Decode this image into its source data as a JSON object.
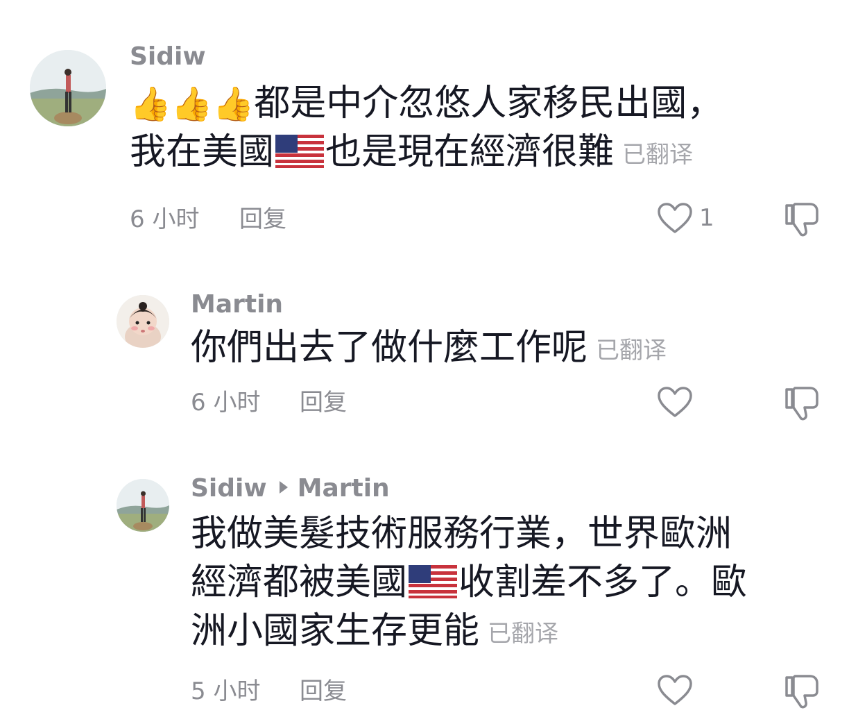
{
  "comments": [
    {
      "username": "Sidiw",
      "emoji": "👍👍👍",
      "line1": "都是中介忽悠人家移民出國，",
      "line2a": "我在美國",
      "line2b": "也是現在經濟很難",
      "translated": "已翻译",
      "time": "6 小时",
      "reply": "回复",
      "likes": "1"
    },
    {
      "username": "Martin",
      "line1": "你們出去了做什麼工作呢",
      "translated": "已翻译",
      "time": "6 小时",
      "reply": "回复"
    },
    {
      "username": "Sidiw",
      "reply_to": "Martin",
      "line1": "我做美髮技術服務行業，世界歐洲",
      "line2a": "經濟都被美國",
      "line2b": "收割差不多了。歐",
      "line3": "洲小國家生存更能",
      "translated": "已翻译",
      "time": "5 小时",
      "reply": "回复"
    }
  ]
}
